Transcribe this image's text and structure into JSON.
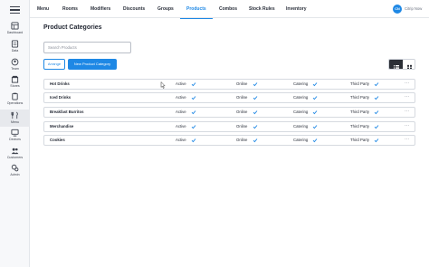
{
  "sidebar": {
    "items": [
      {
        "label": "Dashboard",
        "icon": "dashboard-icon"
      },
      {
        "label": "Data",
        "icon": "data-icon"
      },
      {
        "label": "Team",
        "icon": "team-icon"
      },
      {
        "label": "Stores",
        "icon": "stores-icon"
      },
      {
        "label": "Operations",
        "icon": "operations-icon"
      },
      {
        "label": "Menu",
        "icon": "menu-icon",
        "active": true
      },
      {
        "label": "Devices",
        "icon": "devices-icon"
      },
      {
        "label": "Customers",
        "icon": "customers-icon"
      },
      {
        "label": "Admin",
        "icon": "admin-icon"
      }
    ]
  },
  "topbar": {
    "tabs": [
      "Menu",
      "Rooms",
      "Modifiers",
      "Discounts",
      "Groups",
      "Products",
      "Combos",
      "Stock Rules",
      "Inventory"
    ],
    "active_tab": "Products",
    "user": {
      "initials": "CN",
      "name": "Citrip Now"
    }
  },
  "page": {
    "title": "Product Categories",
    "search_placeholder": "Search Products",
    "arrange_label": "Arrange",
    "new_label": "New Product Category"
  },
  "categories": [
    {
      "name": "Hot Drinks",
      "status": "Active",
      "online": "Online",
      "catering": "Catering",
      "third_party": "Third Party"
    },
    {
      "name": "Iced Drinks",
      "status": "Active",
      "online": "Online",
      "catering": "Catering",
      "third_party": "Third Party"
    },
    {
      "name": "Breakfast Burritos",
      "status": "Active",
      "online": "Online",
      "catering": "Catering",
      "third_party": "Third Party"
    },
    {
      "name": "Merchandise",
      "status": "Active",
      "online": "Online",
      "catering": "Catering",
      "third_party": "Third Party"
    },
    {
      "name": "Cookies",
      "status": "Active",
      "online": "Online",
      "catering": "Catering",
      "third_party": "Third Party"
    }
  ],
  "colors": {
    "accent": "#1e88e5",
    "check": "#1e88e5",
    "sidebar_bg": "#f7f8fa"
  }
}
